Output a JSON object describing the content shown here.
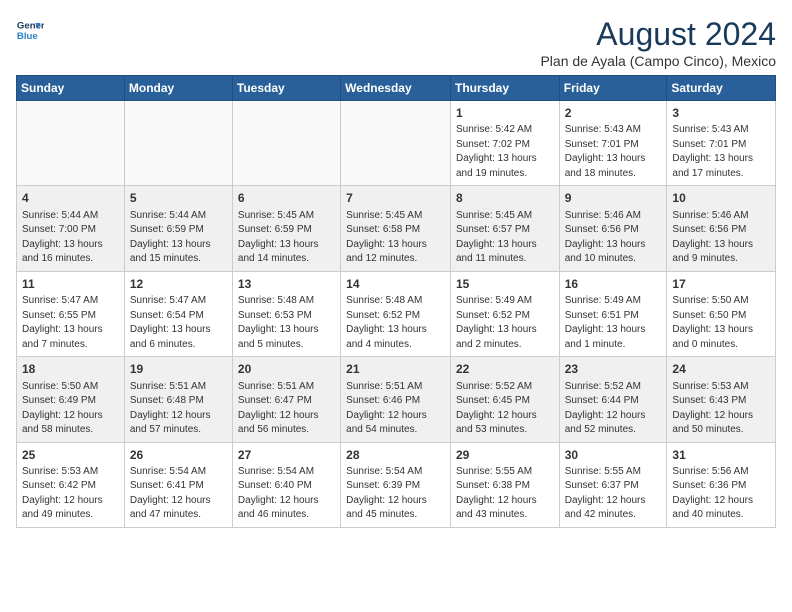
{
  "logo": {
    "line1": "General",
    "line2": "Blue"
  },
  "title": "August 2024",
  "subtitle": "Plan de Ayala (Campo Cinco), Mexico",
  "weekdays": [
    "Sunday",
    "Monday",
    "Tuesday",
    "Wednesday",
    "Thursday",
    "Friday",
    "Saturday"
  ],
  "weeks": [
    [
      {
        "day": "",
        "detail": ""
      },
      {
        "day": "",
        "detail": ""
      },
      {
        "day": "",
        "detail": ""
      },
      {
        "day": "",
        "detail": ""
      },
      {
        "day": "1",
        "detail": "Sunrise: 5:42 AM\nSunset: 7:02 PM\nDaylight: 13 hours\nand 19 minutes."
      },
      {
        "day": "2",
        "detail": "Sunrise: 5:43 AM\nSunset: 7:01 PM\nDaylight: 13 hours\nand 18 minutes."
      },
      {
        "day": "3",
        "detail": "Sunrise: 5:43 AM\nSunset: 7:01 PM\nDaylight: 13 hours\nand 17 minutes."
      }
    ],
    [
      {
        "day": "4",
        "detail": "Sunrise: 5:44 AM\nSunset: 7:00 PM\nDaylight: 13 hours\nand 16 minutes."
      },
      {
        "day": "5",
        "detail": "Sunrise: 5:44 AM\nSunset: 6:59 PM\nDaylight: 13 hours\nand 15 minutes."
      },
      {
        "day": "6",
        "detail": "Sunrise: 5:45 AM\nSunset: 6:59 PM\nDaylight: 13 hours\nand 14 minutes."
      },
      {
        "day": "7",
        "detail": "Sunrise: 5:45 AM\nSunset: 6:58 PM\nDaylight: 13 hours\nand 12 minutes."
      },
      {
        "day": "8",
        "detail": "Sunrise: 5:45 AM\nSunset: 6:57 PM\nDaylight: 13 hours\nand 11 minutes."
      },
      {
        "day": "9",
        "detail": "Sunrise: 5:46 AM\nSunset: 6:56 PM\nDaylight: 13 hours\nand 10 minutes."
      },
      {
        "day": "10",
        "detail": "Sunrise: 5:46 AM\nSunset: 6:56 PM\nDaylight: 13 hours\nand 9 minutes."
      }
    ],
    [
      {
        "day": "11",
        "detail": "Sunrise: 5:47 AM\nSunset: 6:55 PM\nDaylight: 13 hours\nand 7 minutes."
      },
      {
        "day": "12",
        "detail": "Sunrise: 5:47 AM\nSunset: 6:54 PM\nDaylight: 13 hours\nand 6 minutes."
      },
      {
        "day": "13",
        "detail": "Sunrise: 5:48 AM\nSunset: 6:53 PM\nDaylight: 13 hours\nand 5 minutes."
      },
      {
        "day": "14",
        "detail": "Sunrise: 5:48 AM\nSunset: 6:52 PM\nDaylight: 13 hours\nand 4 minutes."
      },
      {
        "day": "15",
        "detail": "Sunrise: 5:49 AM\nSunset: 6:52 PM\nDaylight: 13 hours\nand 2 minutes."
      },
      {
        "day": "16",
        "detail": "Sunrise: 5:49 AM\nSunset: 6:51 PM\nDaylight: 13 hours\nand 1 minute."
      },
      {
        "day": "17",
        "detail": "Sunrise: 5:50 AM\nSunset: 6:50 PM\nDaylight: 13 hours\nand 0 minutes."
      }
    ],
    [
      {
        "day": "18",
        "detail": "Sunrise: 5:50 AM\nSunset: 6:49 PM\nDaylight: 12 hours\nand 58 minutes."
      },
      {
        "day": "19",
        "detail": "Sunrise: 5:51 AM\nSunset: 6:48 PM\nDaylight: 12 hours\nand 57 minutes."
      },
      {
        "day": "20",
        "detail": "Sunrise: 5:51 AM\nSunset: 6:47 PM\nDaylight: 12 hours\nand 56 minutes."
      },
      {
        "day": "21",
        "detail": "Sunrise: 5:51 AM\nSunset: 6:46 PM\nDaylight: 12 hours\nand 54 minutes."
      },
      {
        "day": "22",
        "detail": "Sunrise: 5:52 AM\nSunset: 6:45 PM\nDaylight: 12 hours\nand 53 minutes."
      },
      {
        "day": "23",
        "detail": "Sunrise: 5:52 AM\nSunset: 6:44 PM\nDaylight: 12 hours\nand 52 minutes."
      },
      {
        "day": "24",
        "detail": "Sunrise: 5:53 AM\nSunset: 6:43 PM\nDaylight: 12 hours\nand 50 minutes."
      }
    ],
    [
      {
        "day": "25",
        "detail": "Sunrise: 5:53 AM\nSunset: 6:42 PM\nDaylight: 12 hours\nand 49 minutes."
      },
      {
        "day": "26",
        "detail": "Sunrise: 5:54 AM\nSunset: 6:41 PM\nDaylight: 12 hours\nand 47 minutes."
      },
      {
        "day": "27",
        "detail": "Sunrise: 5:54 AM\nSunset: 6:40 PM\nDaylight: 12 hours\nand 46 minutes."
      },
      {
        "day": "28",
        "detail": "Sunrise: 5:54 AM\nSunset: 6:39 PM\nDaylight: 12 hours\nand 45 minutes."
      },
      {
        "day": "29",
        "detail": "Sunrise: 5:55 AM\nSunset: 6:38 PM\nDaylight: 12 hours\nand 43 minutes."
      },
      {
        "day": "30",
        "detail": "Sunrise: 5:55 AM\nSunset: 6:37 PM\nDaylight: 12 hours\nand 42 minutes."
      },
      {
        "day": "31",
        "detail": "Sunrise: 5:56 AM\nSunset: 6:36 PM\nDaylight: 12 hours\nand 40 minutes."
      }
    ]
  ]
}
